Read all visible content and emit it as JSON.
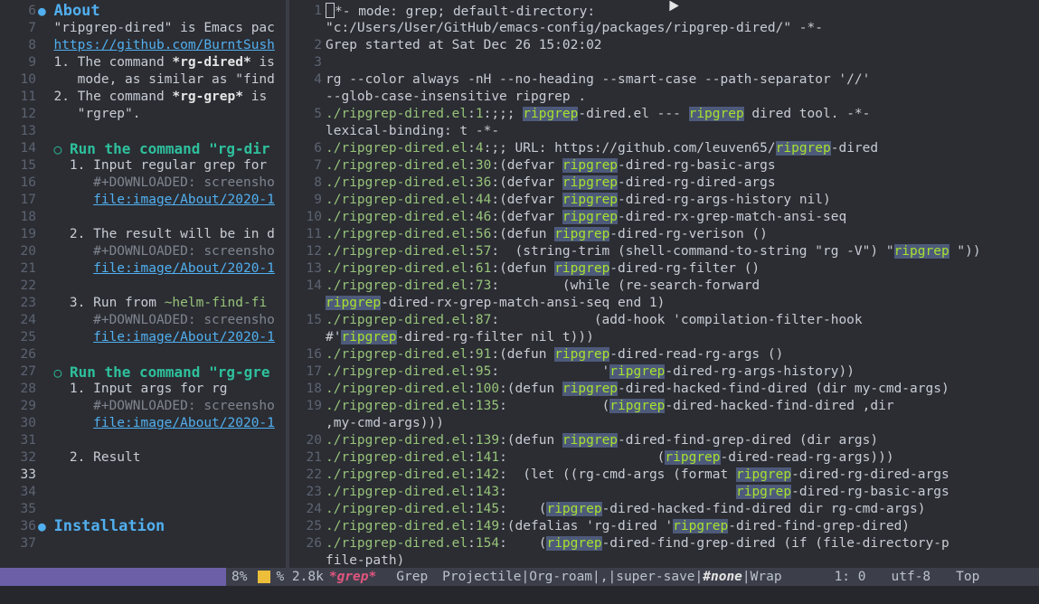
{
  "left_pane": {
    "lines": [
      {
        "n": "6",
        "html": "<span class='bullet'>●</span> <span class='hdr'>About</span>"
      },
      {
        "n": "7",
        "html": "  \"ripgrep-dired\" is Emacs pac"
      },
      {
        "n": "8",
        "html": "  <span class='link'>https://github.com/BurntSush</span>"
      },
      {
        "n": "9",
        "html": "  1. The command <span class='kw'>*rg-dired*</span> is"
      },
      {
        "n": "10",
        "html": "     mode, as similar as \"find"
      },
      {
        "n": "11",
        "html": "  2. The command <span class='kw'>*rg-grep*</span> is"
      },
      {
        "n": "12",
        "html": "     \"rgrep\"."
      },
      {
        "n": "13",
        "html": ""
      },
      {
        "n": "14",
        "html": "  <span class='obullet'>○</span> <span class='sub'>Run the command \"rg-dir</span>"
      },
      {
        "n": "15",
        "html": "    1. Input regular grep for"
      },
      {
        "n": "16",
        "html": "       <span class='dim'>#+DOWNLOADED: screensho</span>"
      },
      {
        "n": "17",
        "html": "       <span class='link'>file:image/About/2020-1</span>"
      },
      {
        "n": "18",
        "html": ""
      },
      {
        "n": "19",
        "html": "    2. The result will be in d"
      },
      {
        "n": "20",
        "html": "       <span class='dim'>#+DOWNLOADED: screensho</span>"
      },
      {
        "n": "21",
        "html": "       <span class='link'>file:image/About/2020-1</span>"
      },
      {
        "n": "22",
        "html": ""
      },
      {
        "n": "23",
        "html": "    3. Run from <span class='fn'>~helm-find-fi</span>"
      },
      {
        "n": "24",
        "html": "       <span class='dim'>#+DOWNLOADED: screensho</span>"
      },
      {
        "n": "25",
        "html": "       <span class='link'>file:image/About/2020-1</span>"
      },
      {
        "n": "26",
        "html": ""
      },
      {
        "n": "27",
        "html": "  <span class='obullet'>○</span> <span class='sub'>Run the command \"rg-gre</span>"
      },
      {
        "n": "28",
        "html": "    1. Input args for rg"
      },
      {
        "n": "29",
        "html": "       <span class='dim'>#+DOWNLOADED: screensho</span>"
      },
      {
        "n": "30",
        "html": "       <span class='link'>file:image/About/2020-1</span>"
      },
      {
        "n": "31",
        "html": ""
      },
      {
        "n": "32",
        "html": "    2. Result"
      },
      {
        "n": "33",
        "html": "",
        "cur": true
      },
      {
        "n": "34",
        "html": ""
      },
      {
        "n": "35",
        "html": ""
      },
      {
        "n": "36",
        "html": "<span class='bullet'>●</span> <span class='hdr'>Installation</span>"
      },
      {
        "n": "37",
        "html": ""
      }
    ]
  },
  "right_pane": {
    "lines": [
      {
        "n": "1",
        "html": "<span class='cursor-box'></span>*- mode: grep; default-directory:"
      },
      {
        "n": "",
        "html": "\"c:/Users/User/GitHub/emacs-config/packages/ripgrep-dired/\" -*-"
      },
      {
        "n": "2",
        "html": "Grep started at Sat Dec 26 15:02:02"
      },
      {
        "n": "3",
        "html": ""
      },
      {
        "n": "4",
        "html": "rg --color always -nH --no-heading --smart-case --path-separator '//'"
      },
      {
        "n": "",
        "html": "--glob-case-insensitive ripgrep ."
      },
      {
        "n": "5",
        "html": "<span class='path'>./ripgrep-dired.el</span>:<span class='num'>1</span>:;;; <span class='hl'>ripgrep</span>-dired.el --- <span class='hl'>ripgrep</span> dired tool. -*-"
      },
      {
        "n": "",
        "html": "lexical-binding: t -*-"
      },
      {
        "n": "6",
        "html": "<span class='path'>./ripgrep-dired.el</span>:<span class='num'>4</span>:;; URL: https://github.com/leuven65/<span class='hl'>ripgrep</span>-dired"
      },
      {
        "n": "7",
        "html": "<span class='path'>./ripgrep-dired.el</span>:<span class='num'>30</span>:(defvar <span class='hl'>ripgrep</span>-dired-rg-basic-args"
      },
      {
        "n": "8",
        "html": "<span class='path'>./ripgrep-dired.el</span>:<span class='num'>36</span>:(defvar <span class='hl'>ripgrep</span>-dired-rg-dired-args"
      },
      {
        "n": "9",
        "html": "<span class='path'>./ripgrep-dired.el</span>:<span class='num'>44</span>:(defvar <span class='hl'>ripgrep</span>-dired-rg-args-history nil)"
      },
      {
        "n": "10",
        "html": "<span class='path'>./ripgrep-dired.el</span>:<span class='num'>46</span>:(defvar <span class='hl'>ripgrep</span>-dired-rx-grep-match-ansi-seq"
      },
      {
        "n": "11",
        "html": "<span class='path'>./ripgrep-dired.el</span>:<span class='num'>56</span>:(defun <span class='hl'>ripgrep</span>-dired-rg-verison ()"
      },
      {
        "n": "12",
        "html": "<span class='path'>./ripgrep-dired.el</span>:<span class='num'>57</span>:  (string-trim (shell-command-to-string \"rg -V\") \"<span class='hl'>ripgrep</span> \"))"
      },
      {
        "n": "13",
        "html": "<span class='path'>./ripgrep-dired.el</span>:<span class='num'>61</span>:(defun <span class='hl'>ripgrep</span>-dired-rg-filter ()"
      },
      {
        "n": "14",
        "html": "<span class='path'>./ripgrep-dired.el</span>:<span class='num'>73</span>:        (while (re-search-forward"
      },
      {
        "n": "",
        "html": "<span class='hl'>ripgrep</span>-dired-rx-grep-match-ansi-seq end 1)"
      },
      {
        "n": "15",
        "html": "<span class='path'>./ripgrep-dired.el</span>:<span class='num'>87</span>:            (add-hook 'compilation-filter-hook"
      },
      {
        "n": "",
        "html": "#'<span class='hl'>ripgrep</span>-dired-rg-filter nil t)))"
      },
      {
        "n": "16",
        "html": "<span class='path'>./ripgrep-dired.el</span>:<span class='num'>91</span>:(defun <span class='hl'>ripgrep</span>-dired-read-rg-args ()"
      },
      {
        "n": "17",
        "html": "<span class='path'>./ripgrep-dired.el</span>:<span class='num'>95</span>:             '<span class='hl'>ripgrep</span>-dired-rg-args-history))"
      },
      {
        "n": "18",
        "html": "<span class='path'>./ripgrep-dired.el</span>:<span class='num'>100</span>:(defun <span class='hl'>ripgrep</span>-dired-hacked-find-dired (dir my-cmd-args)"
      },
      {
        "n": "19",
        "html": "<span class='path'>./ripgrep-dired.el</span>:<span class='num'>135</span>:            (<span class='hl'>ripgrep</span>-dired-hacked-find-dired ,dir"
      },
      {
        "n": "",
        "html": ",my-cmd-args)))"
      },
      {
        "n": "20",
        "html": "<span class='path'>./ripgrep-dired.el</span>:<span class='num'>139</span>:(defun <span class='hl'>ripgrep</span>-dired-find-grep-dired (dir args)"
      },
      {
        "n": "21",
        "html": "<span class='path'>./ripgrep-dired.el</span>:<span class='num'>141</span>:                   (<span class='hl'>ripgrep</span>-dired-read-rg-args)))"
      },
      {
        "n": "22",
        "html": "<span class='path'>./ripgrep-dired.el</span>:<span class='num'>142</span>:  (let ((rg-cmd-args (format <span class='hl'>ripgrep</span>-dired-rg-dired-args"
      },
      {
        "n": "23",
        "html": "<span class='path'>./ripgrep-dired.el</span>:<span class='num'>143</span>:                             <span class='hl'>ripgrep</span>-dired-rg-basic-args"
      },
      {
        "n": "24",
        "html": "<span class='path'>./ripgrep-dired.el</span>:<span class='num'>145</span>:    (<span class='hl'>ripgrep</span>-dired-hacked-find-dired dir rg-cmd-args)"
      },
      {
        "n": "25",
        "html": "<span class='path'>./ripgrep-dired.el</span>:<span class='num'>149</span>:(defalias 'rg-dired '<span class='hl'>ripgrep</span>-dired-find-grep-dired)"
      },
      {
        "n": "26",
        "html": "<span class='path'>./ripgrep-dired.el</span>:<span class='num'>154</span>:    (<span class='hl'>ripgrep</span>-dired-find-grep-dired (if (file-directory-p"
      },
      {
        "n": "",
        "html": "file-path)"
      }
    ]
  },
  "modeline": {
    "percent": "8%",
    "size": "% 2.8k",
    "buffer": "*grep*",
    "mode": "Grep",
    "minor_prefix": "Projectile|Org-roam|,|super-save|",
    "minor_bold": "#none",
    "minor_suffix": "|Wrap",
    "position": "1: 0",
    "encoding": "utf-8",
    "scroll": "Top"
  },
  "colors": {
    "accent": "#51afef",
    "highlight": "#4e5a7a",
    "match": "#a6e22e",
    "modeline_active": "#6c5fa8"
  }
}
